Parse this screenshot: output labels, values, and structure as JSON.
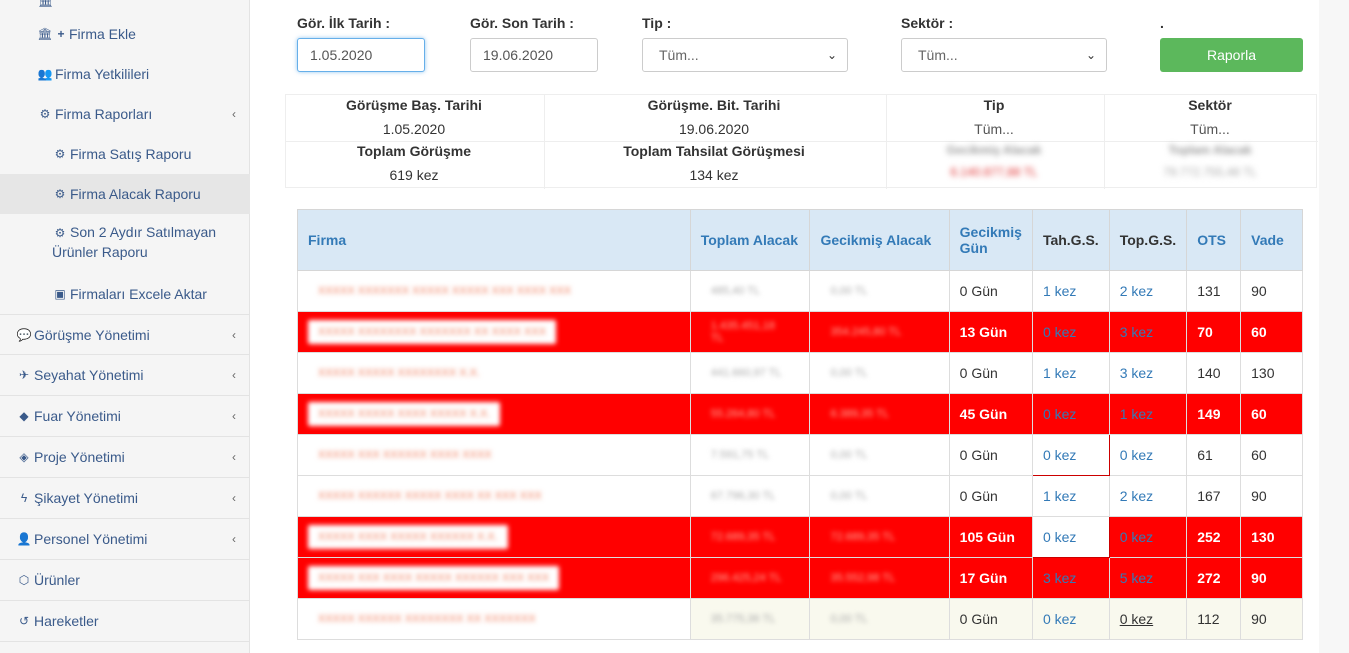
{
  "sidebar": {
    "items": [
      {
        "label": "Firma Ekle",
        "icon": "bank-plus-icon"
      },
      {
        "label": "Firma Yetkilileri",
        "icon": "users-icon"
      },
      {
        "label": "Firma Raporları",
        "icon": "cogs-icon"
      },
      {
        "label": "Firma Satış Raporu",
        "icon": "cogs-icon"
      },
      {
        "label": "Firma Alacak Raporu",
        "icon": "cogs-icon"
      },
      {
        "label": "Son 2 Aydır Satılmayan",
        "label2": "Ürünler Raporu",
        "icon": "cogs-icon"
      },
      {
        "label": "Firmaları Excele Aktar",
        "icon": "excel-icon"
      },
      {
        "label": "Görüşme Yönetimi",
        "icon": "comments-icon"
      },
      {
        "label": "Seyahat Yönetimi",
        "icon": "plane-icon"
      },
      {
        "label": "Fuar Yönetimi",
        "icon": "tag-icon"
      },
      {
        "label": "Proje Yönetimi",
        "icon": "cube-icon"
      },
      {
        "label": "Şikayet Yönetimi",
        "icon": "bolt-icon"
      },
      {
        "label": "Personel Yönetimi",
        "icon": "user-icon"
      },
      {
        "label": "Ürünler",
        "icon": "cubes-icon"
      },
      {
        "label": "Hareketler",
        "icon": "history-icon"
      }
    ]
  },
  "filters": {
    "start_label": "Gör. İlk Tarih :",
    "start_value": "1.05.2020",
    "end_label": "Gör. Son Tarih :",
    "end_value": "19.06.2020",
    "tip_label": "Tip :",
    "tip_value": "Tüm...",
    "sektor_label": "Sektör :",
    "sektor_value": "Tüm...",
    "dot_label": ".",
    "button_label": "Raporla"
  },
  "summary": {
    "bas_tarihi_label": "Görüşme Baş. Tarihi",
    "bas_tarihi_value": "1.05.2020",
    "bit_tarihi_label": "Görüşme. Bit. Tarihi",
    "bit_tarihi_value": "19.06.2020",
    "tip_label": "Tip",
    "tip_value": "Tüm...",
    "sektor_label": "Sektör",
    "sektor_value": "Tüm...",
    "toplam_gorusme_label": "Toplam Görüşme",
    "toplam_gorusme_value": "619 kez",
    "tahsilat_label": "Toplam Tahsilat Görüşmesi",
    "tahsilat_value": "134 kez",
    "gecikmis_label": "Gecikmiş Alacak",
    "gecikmis_value": "6.140.877,88 TL",
    "toplam_alacak_label": "Toplam Alacak",
    "toplam_alacak_value": "79.772.755,48 TL"
  },
  "table": {
    "headers": [
      "Firma",
      "Toplam Alacak",
      "Gecikmiş Alacak",
      "Gecikmiş Gün",
      "Tah.G.S.",
      "Top.G.S.",
      "OTS",
      "Vade"
    ],
    "rows": [
      {
        "style": "white",
        "firma": "XXXXX XXXXXXX XXXXX XXXXX XXX XXXX XXX",
        "toplam": "485,40 TL",
        "gecikmis": "0,00 TL",
        "gun": "0 Gün",
        "tah": "1 kez",
        "top": "2 kez",
        "ots": "131",
        "vade": "90"
      },
      {
        "style": "red",
        "firma": "XXXXX XXXXXXXX XXXXXXX XX XXXX XXX",
        "toplam": "1.435.451,18 TL",
        "gecikmis": "354.245,80 TL",
        "gun": "13 Gün",
        "tah": "0 kez",
        "top": "3 kez",
        "ots": "70",
        "vade": "60"
      },
      {
        "style": "white",
        "firma": "XXXXX XXXXX XXXXXXXX X.X.",
        "toplam": "441.660,97 TL",
        "gecikmis": "0,00 TL",
        "gun": "0 Gün",
        "tah": "1 kez",
        "top": "3 kez",
        "ots": "140",
        "vade": "130"
      },
      {
        "style": "red",
        "firma": "XXXXX XXXXX XXXX XXXXX X.X.",
        "toplam": "55.264,80 TL",
        "gecikmis": "6.389,35 TL",
        "gun": "45 Gün",
        "tah": "0 kez",
        "top": "1 kez",
        "ots": "149",
        "vade": "60"
      },
      {
        "style": "white",
        "firma": "XXXXX XXX XXXXXX XXXX XXXX",
        "toplam": "7.591,75 TL",
        "gecikmis": "0,00 TL",
        "gun": "0 Gün",
        "tah": "0 kez",
        "top": "0 kez",
        "ots": "61",
        "vade": "60",
        "tah_box": true
      },
      {
        "style": "white",
        "firma": "XXXXX XXXXXX XXXXX XXXX XX XXX XXX",
        "toplam": "67.796,30 TL",
        "gecikmis": "0,00 TL",
        "gun": "0 Gün",
        "tah": "1 kez",
        "top": "2 kez",
        "ots": "167",
        "vade": "90"
      },
      {
        "style": "red",
        "firma": "XXXXX XXXX XXXXX XXXXXX X.X.",
        "toplam": "72.689,35 TL",
        "gecikmis": "72.689,35 TL",
        "gun": "105 Gün",
        "tah": "0 kez",
        "top": "0 kez",
        "ots": "252",
        "vade": "130",
        "tah_box": true
      },
      {
        "style": "red",
        "firma": "XXXXX XXX XXXX XXXXX XXXXXX XXX XXX",
        "toplam": "296.425,24 TL",
        "gecikmis": "35.552,98 TL",
        "gun": "17 Gün",
        "tah": "3 kez",
        "top": "5 kez",
        "ots": "272",
        "vade": "90"
      },
      {
        "style": "cream",
        "firma": "XXXXX XXXXXX XXXXXXXX XX XXXXXXX",
        "toplam": "35.775,36 TL",
        "gecikmis": "0,00 TL",
        "gun": "0 Gün",
        "tah": "0 kez",
        "top": "0 kez",
        "ots": "112",
        "vade": "90",
        "top_underline": true
      }
    ]
  },
  "colors": {
    "accent": "#337ab7",
    "danger_row": "#ff0000",
    "button": "#5cb85c",
    "header_bg": "#d9e8f5"
  }
}
